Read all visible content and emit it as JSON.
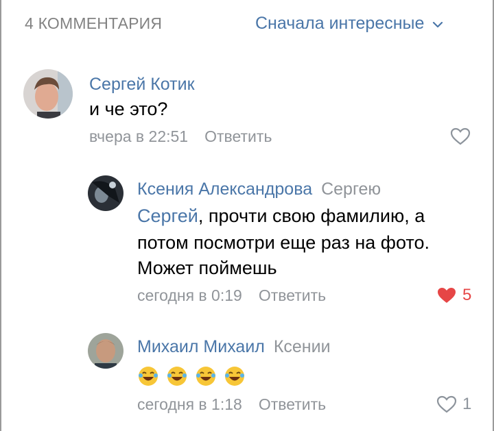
{
  "header": {
    "count_label": "4 КОММЕНТАРИЯ",
    "sort_label": "Сначала интересные",
    "sort_icon": "chevron-down-icon"
  },
  "colors": {
    "link": "#4a76a8",
    "meta": "#909499",
    "liked": "#e64646"
  },
  "comments": [
    {
      "author": "Сергей Котик",
      "text": "и че это?",
      "date": "вчера в 22:51",
      "reply_label": "Ответить",
      "liked": false,
      "likes": ""
    },
    {
      "author": "Ксения Александрова",
      "reply_to": "Сергею",
      "mention": "Сергей",
      "text_line1": ", прочти свою фамилию, а",
      "text_line2": "потом посмотри еще раз на фото.",
      "text_line3": "Может поймешь",
      "date": "сегодня в 0:19",
      "reply_label": "Ответить",
      "liked": true,
      "likes": "5"
    },
    {
      "author": "Михаил Михаил",
      "reply_to": "Ксении",
      "emoji": [
        "laughing-crying-emoji",
        "laughing-crying-emoji",
        "laughing-crying-emoji",
        "laughing-crying-emoji"
      ],
      "date": "сегодня в 1:18",
      "reply_label": "Ответить",
      "liked": false,
      "likes": "1"
    }
  ]
}
